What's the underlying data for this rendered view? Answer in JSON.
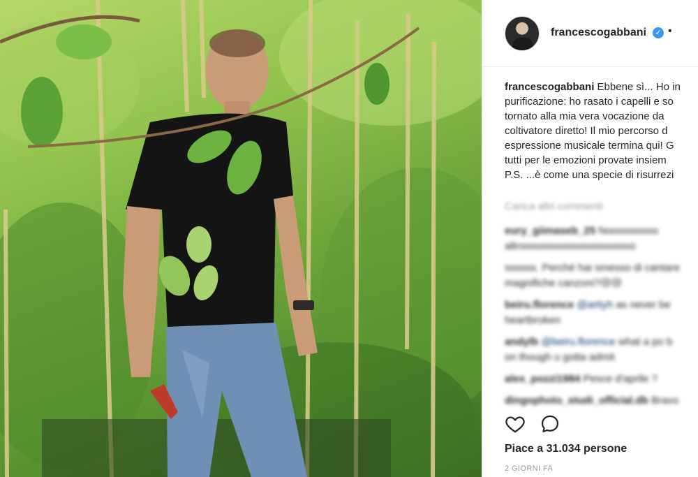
{
  "post": {
    "image_alt": "Man in black t-shirt and jeans standing among tall garden plants",
    "author": {
      "username": "francescogabbani",
      "verified_icon": "check-icon",
      "dot": "•"
    },
    "caption": {
      "username": "francescogabbani",
      "lines": [
        "Ebbene sì... Ho in",
        "purificazione: ho rasato i capelli e so",
        "tornato alla mia vera vocazione da",
        "coltivatore diretto! Il mio percorso d",
        "espressione musicale termina qui! G",
        "tutti per le emozioni provate insiem",
        "P.S. ...è come una specie di risurrezi"
      ]
    },
    "load_more": "Carica altri commenti",
    "comments": [
      {
        "user": "eury_giimaseb_25",
        "text": "Nooooooooo",
        "line2": "altroooooooooooooooooooo"
      },
      {
        "user": "",
        "text": "ssssss. Perché hai smesso di cantare",
        "line2": "magnifiche canzoni?😢😢"
      },
      {
        "user": "beiru.florence",
        "mention": "@artiyh",
        "text": " as never be",
        "line2": "heartbroken"
      },
      {
        "user": "andylb",
        "mention": "@beiru.florence",
        "text": " what a po b",
        "line2": "on though u gotta admit"
      },
      {
        "user": "alex_pozzi1984",
        "text": "Pesce d'aprile ?",
        "line2": ""
      },
      {
        "user": "dingophoto_studi_official.db",
        "text": "Bravo",
        "line2": ""
      }
    ],
    "likes_text": "Piace a 31.034 persone",
    "time_ago": "2 GIORNI FA",
    "colors": {
      "accent": "#3897f0",
      "text": "#262626",
      "muted": "#999999",
      "mention": "#003569"
    }
  }
}
